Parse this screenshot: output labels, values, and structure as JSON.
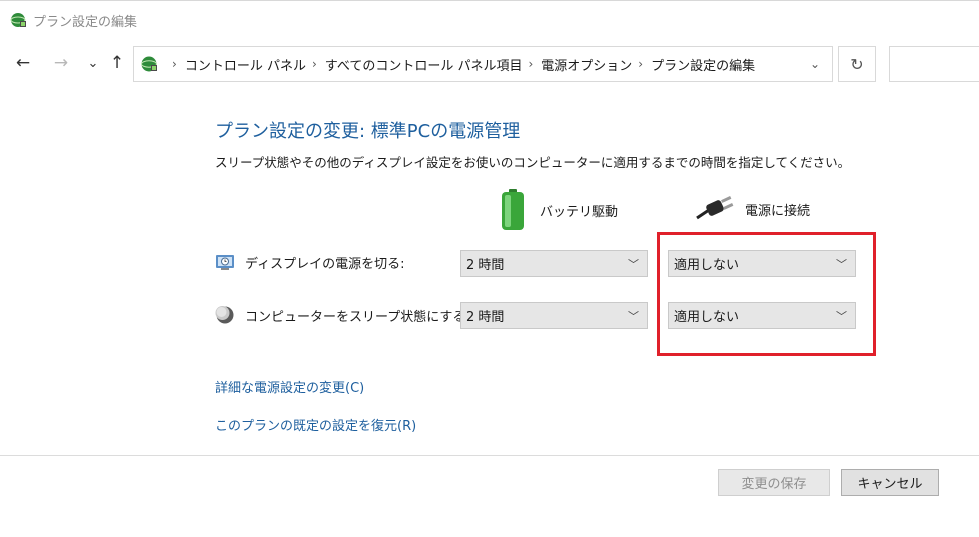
{
  "window": {
    "title": "プラン設定の編集"
  },
  "nav": {
    "back_icon": "←",
    "forward_icon": "→",
    "recent_icon": "⌄",
    "up_icon": "↑",
    "breadcrumb": [
      "コントロール パネル",
      "すべてのコントロール パネル項目",
      "電源オプション",
      "プラン設定の編集"
    ],
    "breadcrumb_sep": "›",
    "dropdown_icon": "⌄",
    "refresh_icon": "↻"
  },
  "main": {
    "title": "プラン設定の変更: 標準PCの電源管理",
    "description": "スリープ状態やその他のディスプレイ設定をお使いのコンピューターに適用するまでの時間を指定してください。",
    "columns": {
      "battery": "バッテリ駆動",
      "plugged_in": "電源に接続"
    },
    "settings": [
      {
        "label": "ディスプレイの電源を切る:",
        "battery_value": "2 時間",
        "plugged_value": "適用しない"
      },
      {
        "label": "コンピューターをスリープ状態にする:",
        "battery_value": "2 時間",
        "plugged_value": "適用しない"
      }
    ],
    "links": {
      "advanced": "詳細な電源設定の変更(C)",
      "restore": "このプランの既定の設定を復元(R)"
    }
  },
  "footer": {
    "save": "変更の保存",
    "cancel": "キャンセル"
  },
  "colors": {
    "link": "#1e5f9e",
    "highlight": "#e0202a"
  }
}
